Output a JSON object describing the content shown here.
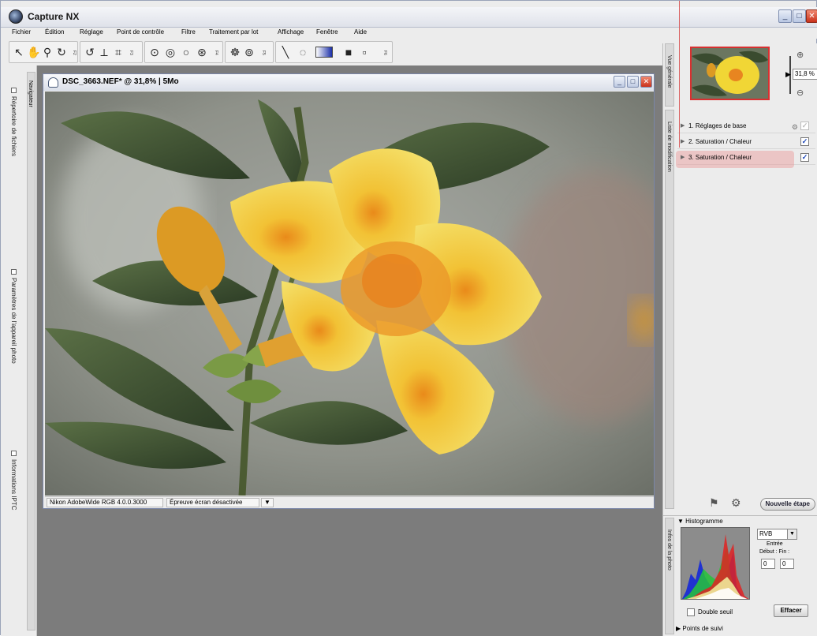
{
  "app": {
    "title": "Capture NX",
    "window_controls": [
      "_",
      "□",
      "✕"
    ]
  },
  "menu": [
    "Fichier",
    "Édition",
    "Réglage",
    "Point de contrôle",
    "Filtre",
    "Traitement par lot",
    "Affichage",
    "Fenêtre",
    "Aide"
  ],
  "toolbar": {
    "fkeys": [
      "F2",
      "F3",
      "F4",
      "F5",
      "F6"
    ]
  },
  "left_dock": {
    "navigator": "Navigateur",
    "tabs": [
      "Répertoire de fichiers",
      "Paramètres de l'appareil photo",
      "Informations IPTC"
    ]
  },
  "document": {
    "title": "DSC_3663.NEF* @ 31,8% | 5Mo",
    "status_profile": "Nikon AdobeWide RGB 4.0.0.3000",
    "status_proof": "Épreuve écran désactivée",
    "status_dropdown": "▼"
  },
  "right_panel": {
    "overview_tab": "Vue générale",
    "zoom_value": "31,8 %",
    "zoom_in": "⊕",
    "zoom_out": "⊖",
    "edit_list_tab": "Liste de modification",
    "steps": [
      {
        "label": "1. Réglages de base",
        "checked": false
      },
      {
        "label": "2. Saturation / Chaleur",
        "checked": true
      },
      {
        "label": "3. Saturation / Chaleur",
        "checked": true
      }
    ],
    "new_step": "Nouvelle étape",
    "photo_info_tab": "Infos de la photo",
    "histogram": {
      "title": "Histogramme",
      "channel": "RVB",
      "entree": "Entrée",
      "debut_fin": "Début : Fin :",
      "start": "0",
      "end": "0",
      "double_threshold": "Double seuil",
      "clear": "Effacer"
    },
    "tracking_points": "Points de suivi"
  },
  "colors": {
    "flower": "#f1d635",
    "leaf": "#3c4f32",
    "background_blur": "#9ea19b",
    "highlight": "#ec9696"
  }
}
